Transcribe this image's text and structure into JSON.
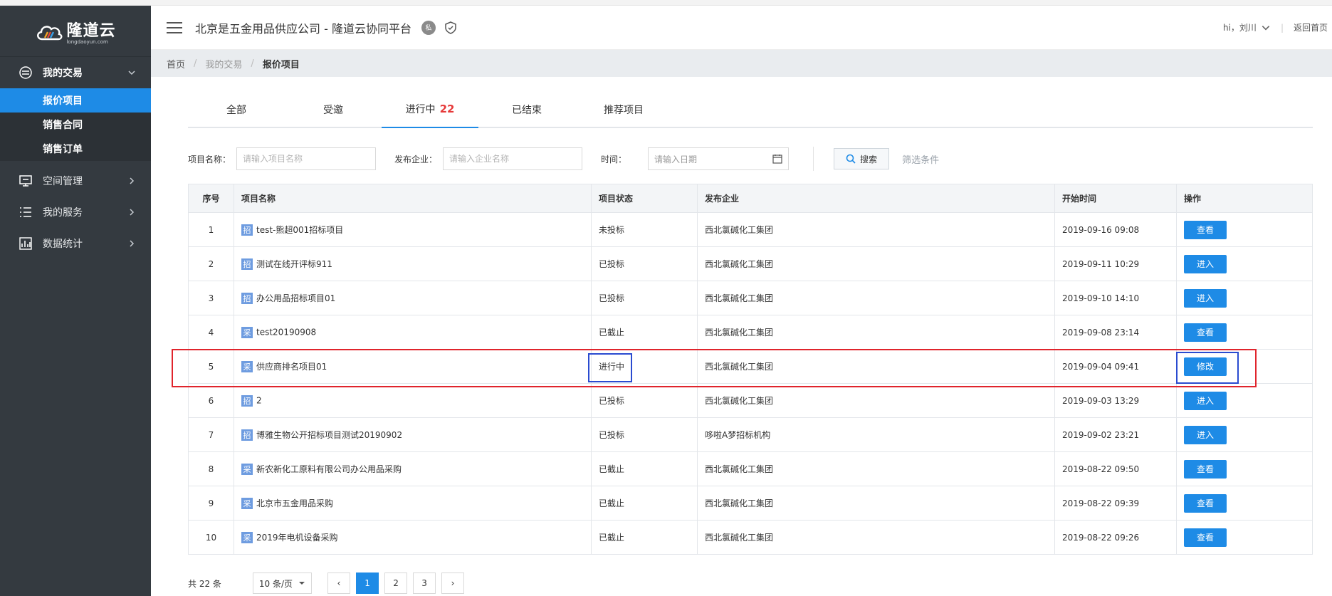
{
  "app": {
    "logo_text": "隆道云",
    "logo_sub": "longdaoyun.com",
    "title": "北京是五金用品供应公司 - 隆道云协同平台",
    "badge": "私"
  },
  "header_right": {
    "user": "hi，刘川",
    "home_link": "返回首页"
  },
  "sidebar": {
    "groups": [
      {
        "label": "我的交易",
        "icon": "trade-icon",
        "expanded": true,
        "items": [
          {
            "label": "报价项目",
            "active": true
          },
          {
            "label": "销售合同",
            "active": false
          },
          {
            "label": "销售订单",
            "active": false
          }
        ]
      },
      {
        "label": "空间管理",
        "icon": "monitor-icon"
      },
      {
        "label": "我的服务",
        "icon": "list-icon"
      },
      {
        "label": "数据统计",
        "icon": "chart-icon"
      }
    ]
  },
  "breadcrumb": [
    "首页",
    "我的交易",
    "报价项目"
  ],
  "tabs": [
    {
      "label": "全部"
    },
    {
      "label": "受邀"
    },
    {
      "label": "进行中",
      "count": "22",
      "active": true
    },
    {
      "label": "已结束"
    },
    {
      "label": "推荐项目"
    }
  ],
  "filters": {
    "name_label": "项目名称：",
    "name_placeholder": "请输入项目名称",
    "company_label": "发布企业：",
    "company_placeholder": "请输入企业名称",
    "time_label": "时间：",
    "time_placeholder": "请输入日期",
    "search_btn": "搜索",
    "filter_link": "筛选条件"
  },
  "table": {
    "headers": [
      "序号",
      "项目名称",
      "项目状态",
      "发布企业",
      "开始时间",
      "操作"
    ],
    "rows": [
      {
        "no": "1",
        "tag": "招",
        "name": "test-熊超001招标项目",
        "status": "未投标",
        "company": "西北氯碱化工集团",
        "start": "2019-09-16 09:08",
        "op": "查看"
      },
      {
        "no": "2",
        "tag": "招",
        "name": "测试在线开评标911",
        "status": "已投标",
        "company": "西北氯碱化工集团",
        "start": "2019-09-11 10:29",
        "op": "进入"
      },
      {
        "no": "3",
        "tag": "招",
        "name": "办公用品招标项目01",
        "status": "已投标",
        "company": "西北氯碱化工集团",
        "start": "2019-09-10 14:10",
        "op": "进入"
      },
      {
        "no": "4",
        "tag": "采",
        "name": "test20190908",
        "status": "已截止",
        "company": "西北氯碱化工集团",
        "start": "2019-09-08 23:14",
        "op": "查看"
      },
      {
        "no": "5",
        "tag": "采",
        "name": "供应商排名项目01",
        "status": "进行中",
        "company": "西北氯碱化工集团",
        "start": "2019-09-04 09:41",
        "op": "修改"
      },
      {
        "no": "6",
        "tag": "招",
        "name": "2",
        "status": "已投标",
        "company": "西北氯碱化工集团",
        "start": "2019-09-03 13:29",
        "op": "进入"
      },
      {
        "no": "7",
        "tag": "招",
        "name": "博雅生物公开招标项目测试20190902",
        "status": "已投标",
        "company": "哆啦A梦招标机构",
        "start": "2019-09-02 23:21",
        "op": "进入"
      },
      {
        "no": "8",
        "tag": "采",
        "name": "新农新化工原料有限公司办公用品采购",
        "status": "已截止",
        "company": "西北氯碱化工集团",
        "start": "2019-08-22 09:50",
        "op": "查看"
      },
      {
        "no": "9",
        "tag": "采",
        "name": "北京市五金用品采购",
        "status": "已截止",
        "company": "西北氯碱化工集团",
        "start": "2019-08-22 09:39",
        "op": "查看"
      },
      {
        "no": "10",
        "tag": "采",
        "name": "2019年电机设备采购",
        "status": "已截止",
        "company": "西北氯碱化工集团",
        "start": "2019-08-22 09:26",
        "op": "查看"
      }
    ]
  },
  "pager": {
    "total": "共 22 条",
    "size": "10 条/页",
    "prev": "‹",
    "next": "›",
    "pages": [
      "1",
      "2",
      "3"
    ],
    "current": "1"
  },
  "colors": {
    "primary": "#1e8be6",
    "sidebar_bg": "#343a40",
    "highlight_red": "#e0242c",
    "highlight_blue": "#2a4bd0"
  }
}
